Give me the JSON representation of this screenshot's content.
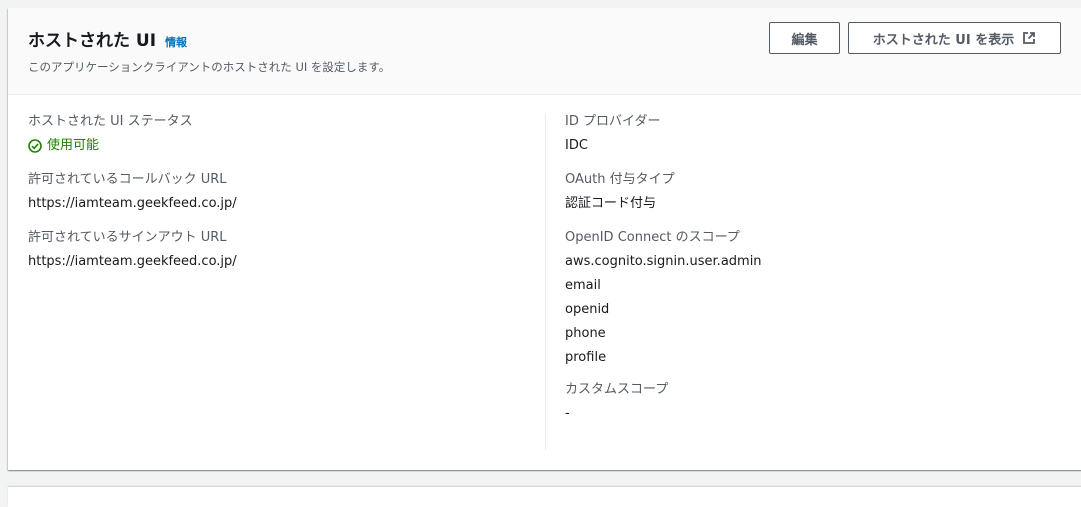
{
  "header": {
    "title": "ホストされた UI",
    "info_label": "情報",
    "subtitle": "このアプリケーションクライアントのホストされた UI を設定します。",
    "edit_label": "編集",
    "view_label": "ホストされた UI を表示"
  },
  "left": {
    "status_label": "ホストされた UI ステータス",
    "status_value": "使用可能",
    "callback_label": "許可されているコールバック URL",
    "callback_value": "https://iamteam.geekfeed.co.jp/",
    "signout_label": "許可されているサインアウト URL",
    "signout_value": "https://iamteam.geekfeed.co.jp/"
  },
  "right": {
    "idp_label": "ID プロバイダー",
    "idp_value": "IDC",
    "oauth_label": "OAuth 付与タイプ",
    "oauth_value": "認証コード付与",
    "scopes_label": "OpenID Connect のスコープ",
    "scopes": [
      "aws.cognito.signin.user.admin",
      "email",
      "openid",
      "phone",
      "profile"
    ],
    "custom_label": "カスタムスコープ",
    "custom_value": "-"
  },
  "colors": {
    "success": "#1d8102",
    "link": "#0073bb",
    "text": "#16191f",
    "secondary_text": "#545b64"
  },
  "icons": {
    "status": "check-circle-icon",
    "external": "external-link-icon"
  }
}
